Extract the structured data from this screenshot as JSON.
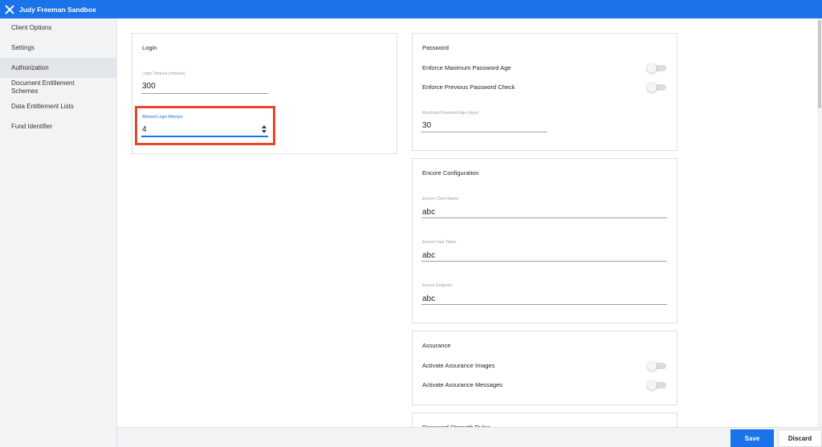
{
  "window": {
    "title": "Judy Freeman Sandbox"
  },
  "sidebar": {
    "items": [
      {
        "label": "Client Options"
      },
      {
        "label": "Settings"
      },
      {
        "label": "Authorization"
      },
      {
        "label": "Document Entitlement Schemes"
      },
      {
        "label": "Data Entitlement Lists"
      },
      {
        "label": "Fund Identifier"
      }
    ],
    "active": "Authorization"
  },
  "login": {
    "title": "Login",
    "timeout_label": "Login Timeout (minutes)",
    "timeout_value": "300",
    "attempts_label": "Allowed Login Attemps",
    "attempts_value": "4"
  },
  "password": {
    "title": "Password",
    "enforce_max_age": "Enforce Maximum Password Age",
    "enforce_previous": "Enforce Previous Password Check",
    "max_age_label": "Maximum Password Age (days)",
    "max_age_value": "30"
  },
  "encore": {
    "title": "Encore Configuration",
    "client_name_label": "Encore Client Name",
    "client_name_value": "abc",
    "user_token_label": "Encore User Token",
    "user_token_value": "abc",
    "endpoint_label": "Encore Endpoint",
    "endpoint_value": "abc"
  },
  "assurance": {
    "title": "Assurance",
    "images": "Activate Assurance Images",
    "messages": "Activate Assurance Messages"
  },
  "password_strength": {
    "title": "Password Strength Rules"
  },
  "footer": {
    "save_label": "Save",
    "discard_label": "Discard"
  },
  "colors": {
    "accent": "#1a73e8",
    "highlight": "#e8452a"
  }
}
